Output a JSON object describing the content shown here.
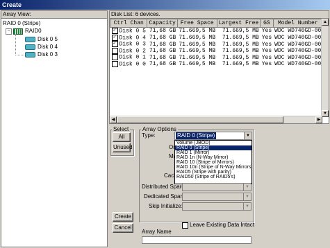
{
  "window": {
    "title": "Create"
  },
  "array_view": {
    "caption": "Array View:",
    "root": "RAID 0    (Stripe)",
    "array": "RAID0",
    "disks": [
      "Disk 0 5",
      "Disk 0 4",
      "Disk 0 3"
    ]
  },
  "disk_list": {
    "caption": "Disk List: 6 devices.",
    "columns": [
      "Ctrl Chan",
      "Capacity",
      "Free Space",
      "Largest Free",
      "GS",
      "Model Number"
    ],
    "rows": [
      {
        "checked": true,
        "disk": "Disk  0 5",
        "capacity": "71,68 GB",
        "free": "71.669,5 MB",
        "largest": "71.669,5 MB",
        "gs": "Yes",
        "model": "WDC WD740GD-00"
      },
      {
        "checked": true,
        "disk": "Disk  0 4",
        "capacity": "71,68 GB",
        "free": "71.669,5 MB",
        "largest": "71.669,5 MB",
        "gs": "Yes",
        "model": "WDC WD740GD-00"
      },
      {
        "checked": true,
        "disk": "Disk  0 3",
        "capacity": "71,68 GB",
        "free": "71.669,5 MB",
        "largest": "71.669,5 MB",
        "gs": "Yes",
        "model": "WDC WD740GD-00"
      },
      {
        "checked": false,
        "disk": "Disk  0 2",
        "capacity": "71,68 GB",
        "free": "71.669,5 MB",
        "largest": "71.669,5 MB",
        "gs": "Yes",
        "model": "WDC WD740GD-00"
      },
      {
        "checked": false,
        "disk": "Disk  0 1",
        "capacity": "71,68 GB",
        "free": "71.669,5 MB",
        "largest": "71.669,5 MB",
        "gs": "Yes",
        "model": "WDC WD740GD-00"
      },
      {
        "checked": false,
        "disk": "Disk  0 0",
        "capacity": "71,68 GB",
        "free": "71.669,5 MB",
        "largest": "71.669,5 MB",
        "gs": "Yes",
        "model": "WDC WD740GD-00"
      }
    ]
  },
  "select": {
    "label": "Select",
    "all": "All",
    "unused": "Unused"
  },
  "buttons": {
    "create": "Create",
    "cancel": "Cancel"
  },
  "options": {
    "label": "Array Options",
    "type_label": "Type:",
    "type_value": "RAID 0    (Stripe)",
    "hidden_labels": [
      "Org",
      "Ma",
      "Cach"
    ],
    "dropdown_items": [
      {
        "label": "Volume       (JBOD)",
        "selected": false
      },
      {
        "label": "RAID 0      (Stripe)",
        "selected": true
      },
      {
        "label": "RAID 1      (Mirror)",
        "selected": false
      },
      {
        "label": "RAID 1n     (N-Way Mirror)",
        "selected": false
      },
      {
        "label": "RAID 10     (Stripe of Mirrors)",
        "selected": false
      },
      {
        "label": "RAID 10n  (Stripe of N-Way Mirrors)",
        "selected": false
      },
      {
        "label": "RAID5       (Stripe with parity)",
        "selected": false
      },
      {
        "label": "RAID50      (Stripe of RAID5's)",
        "selected": false
      }
    ],
    "distributed_spare": "Distributed Spare:",
    "dedicated_spare": "Dedicated Spare:",
    "skip_initialize": "Skip Initialize:",
    "leave_intact": "Leave Existing Data Intact",
    "array_name_label": "Array Name"
  }
}
